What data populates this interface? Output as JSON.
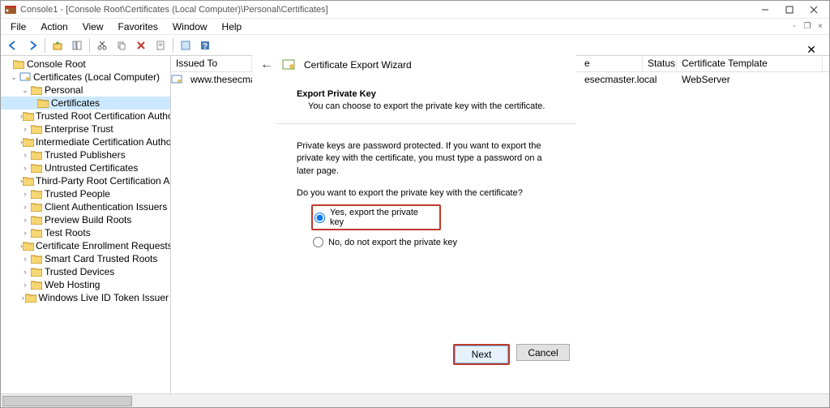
{
  "titlebar": {
    "text": "Console1 - [Console Root\\Certificates (Local Computer)\\Personal\\Certificates]"
  },
  "menu": {
    "file": "File",
    "action": "Action",
    "view": "View",
    "favorites": "Favorites",
    "window": "Window",
    "help": "Help"
  },
  "tree": {
    "root": "Console Root",
    "certificates_lc": "Certificates (Local Computer)",
    "personal": "Personal",
    "certificates": "Certificates",
    "trusted_root": "Trusted Root Certification Authorities",
    "enterprise_trust": "Enterprise Trust",
    "intermediate": "Intermediate Certification Authorities",
    "trusted_publishers": "Trusted Publishers",
    "untrusted": "Untrusted Certificates",
    "third_party": "Third-Party Root Certification Authoritie",
    "trusted_people": "Trusted People",
    "client_auth": "Client Authentication Issuers",
    "preview_build": "Preview Build Roots",
    "test_roots": "Test Roots",
    "cert_enroll": "Certificate Enrollment Requests",
    "smart_card": "Smart Card Trusted Roots",
    "trusted_devices": "Trusted Devices",
    "web_hosting": "Web Hosting",
    "windows_live": "Windows Live ID Token Issuer"
  },
  "list": {
    "headers": {
      "issued_to": "Issued To",
      "issued_by": "e",
      "status": "Status",
      "template": "Certificate Template"
    },
    "rows": [
      {
        "issued_to": "www.thesecmaster.l",
        "issued_by": "esecmaster.local",
        "status": "",
        "template": "WebServer"
      }
    ]
  },
  "dialog": {
    "title": "Certificate Export Wizard",
    "heading": "Export Private Key",
    "sub": "You can choose to export the private key with the certificate.",
    "info": "Private keys are password protected. If you want to export the private key with the certificate, you must type a password on a later page.",
    "question": "Do you want to export the private key with the certificate?",
    "opt_yes": "Yes, export the private key",
    "opt_no": "No, do not export the private key",
    "btn_next": "Next",
    "btn_cancel": "Cancel"
  }
}
